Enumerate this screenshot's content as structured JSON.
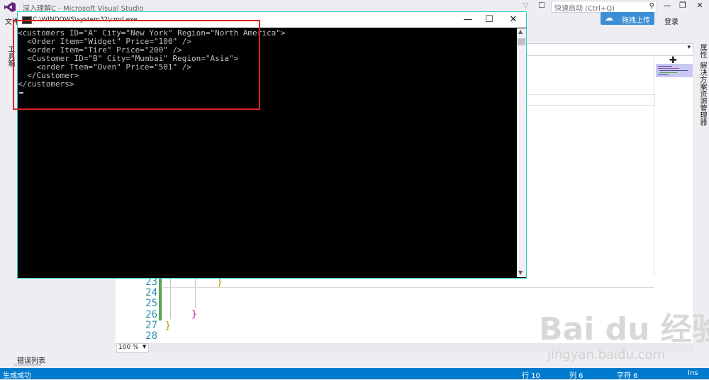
{
  "window": {
    "title": "深入理解C - Microsoft Visual Studio"
  },
  "titlebar": {
    "quick_launch_placeholder": "快速启动 (Ctrl+Q)",
    "minimize": "—",
    "restore": "❐",
    "close": "✕"
  },
  "menubar": {
    "file_label": "文件"
  },
  "upload_button": {
    "label": "拖拽上传"
  },
  "login_label": "登录",
  "left_toolbox": {
    "label": "工具箱"
  },
  "right_tabs": {
    "properties": "属性",
    "solution_explorer": "解决方案资源管理器"
  },
  "cmd": {
    "title": "C:\\WINDOWS\\system32\\cmd.exe",
    "lines": [
      "<customers ID=\"A\" City=\"New York\" Region=\"North America\">",
      "  <Order Item=\"Widget\" Price=\"100\" />",
      "  <order Item=\"Tire\" Price=\"200\" />",
      "  <Customer ID=\"B\" City=\"Mumbai\" Region=\"Asia\">",
      "    <order Ttem=\"Oven\" Price=\"501\" />",
      "  </Customer>",
      "</customers>"
    ]
  },
  "editor": {
    "line_numbers": [
      "23",
      "24",
      "25",
      "26",
      "27",
      "28"
    ],
    "brace_a": "}",
    "brace_b": "}",
    "brace_c": "}",
    "zoom": "100 %"
  },
  "bottom_tab": {
    "error_list": "错误列表"
  },
  "statusbar": {
    "left": "生成成功",
    "line": "行 10",
    "col": "列 6",
    "ch": "字符 6",
    "ins": "Ins"
  },
  "watermark": {
    "text": "Bai du 经验",
    "sub": "jingyan.baidu.com"
  },
  "colors": {
    "status_blue": "#007acc",
    "accent": "#3c8fd6",
    "highlight_red": "#e02020"
  }
}
